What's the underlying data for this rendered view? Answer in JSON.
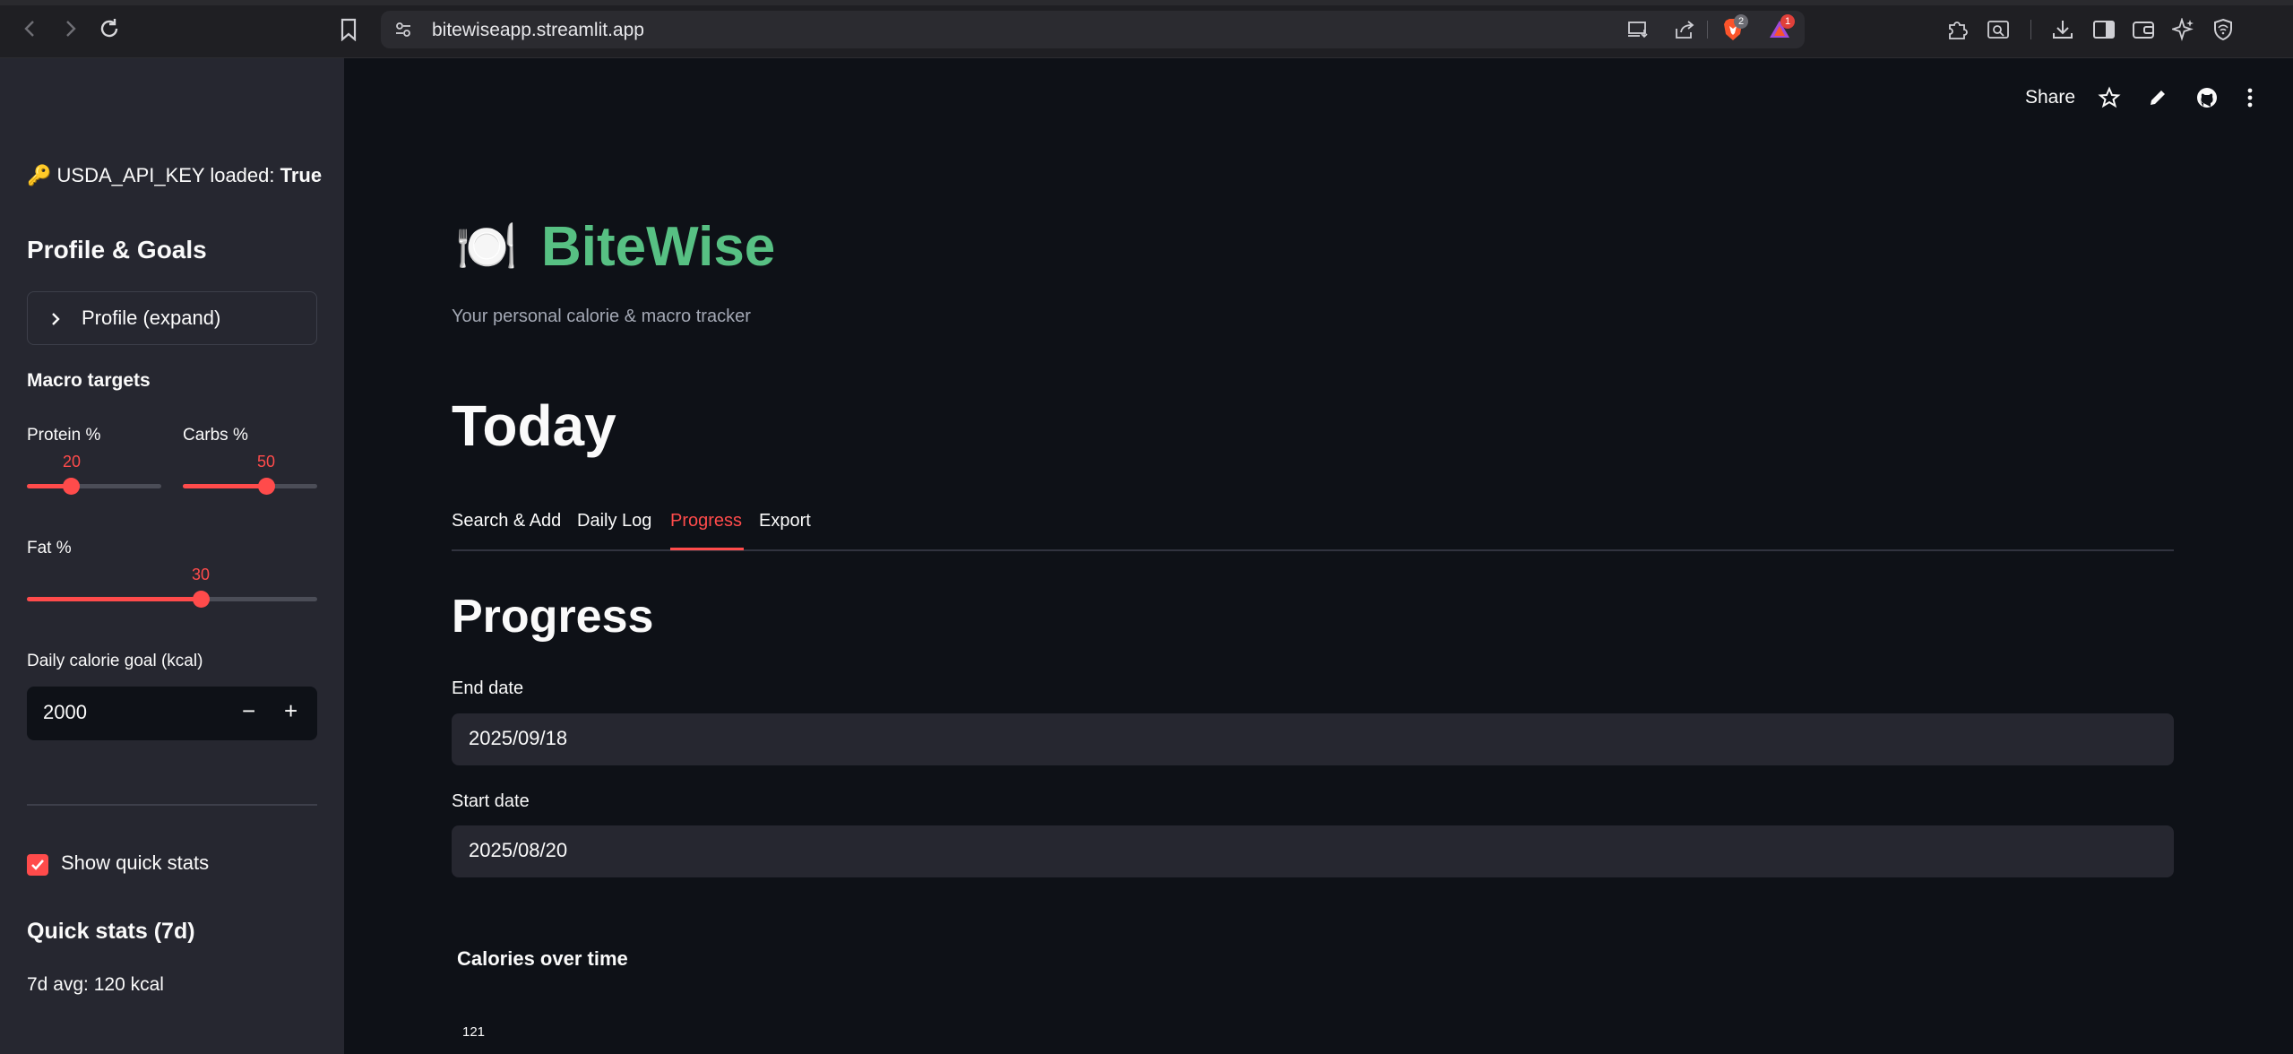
{
  "browser": {
    "url": "bitewiseapp.streamlit.app",
    "brave_badge": "2",
    "alert_badge": "1"
  },
  "toolbar": {
    "share_label": "Share"
  },
  "sidebar": {
    "api_status_icon": "🔑",
    "api_status_label": "USDA_API_KEY loaded:",
    "api_status_value": "True",
    "profile_heading": "Profile & Goals",
    "profile_expander_label": "Profile (expand)",
    "macro_heading": "Macro targets",
    "protein": {
      "label": "Protein %",
      "value": "20",
      "fraction": 0.2
    },
    "carbs": {
      "label": "Carbs %",
      "value": "50",
      "fraction": 0.5
    },
    "fat": {
      "label": "Fat %",
      "value": "30",
      "fraction": 0.3
    },
    "calorie_goal_label": "Daily calorie goal (kcal)",
    "calorie_goal_value": "2000",
    "minus_label": "−",
    "plus_label": "+",
    "quick_stats_checkbox_label": "Show quick stats",
    "quick_stats_checked": true,
    "quick_stats_heading": "Quick stats (7d)",
    "quick_stats_avg": "7d avg: 120 kcal"
  },
  "main": {
    "app_icon": "🍽️",
    "app_title": "BiteWise",
    "app_subtitle": "Your personal calorie & macro tracker",
    "page_heading": "Today",
    "tabs": [
      {
        "label": "Search & Add",
        "active": false
      },
      {
        "label": "Daily Log",
        "active": false
      },
      {
        "label": "Progress",
        "active": true
      },
      {
        "label": "Export",
        "active": false
      }
    ],
    "section_heading": "Progress",
    "end_date_label": "End date",
    "end_date_value": "2025/09/18",
    "start_date_label": "Start date",
    "start_date_value": "2025/08/20",
    "chart_title": "Calories over time",
    "chart_first_tick": "121"
  },
  "colors": {
    "accent": "#ff4b4b",
    "title_green": "#57c083",
    "sidebar_bg": "#262730",
    "main_bg": "#0e1117"
  }
}
